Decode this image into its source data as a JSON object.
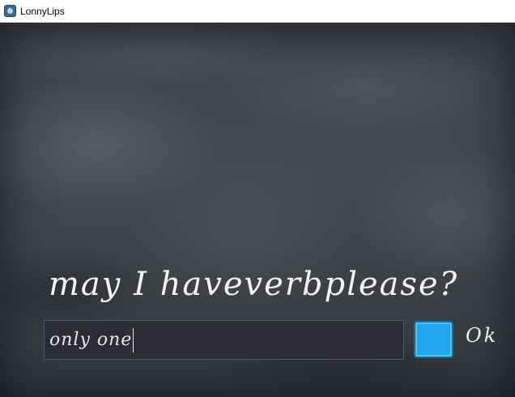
{
  "window": {
    "title": "LonnyLips",
    "icon": "app-icon"
  },
  "board": {
    "prompt": "may I haveverbplease?",
    "input_value": "only one",
    "ok_label": "Ok"
  },
  "colors": {
    "board": "#3f4448",
    "input_bg": "#2b2c34",
    "ok_button": "#1ea7ea",
    "chalk_text": "#f4f4f4"
  }
}
